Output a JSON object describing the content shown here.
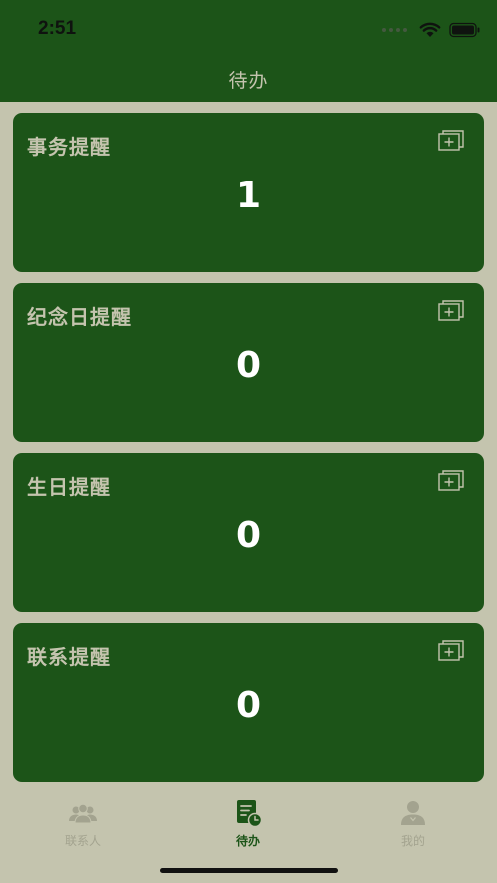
{
  "status": {
    "time": "2:51"
  },
  "nav": {
    "title": "待办"
  },
  "cards": [
    {
      "title": "事务提醒",
      "count": "1"
    },
    {
      "title": "纪念日提醒",
      "count": "0"
    },
    {
      "title": "生日提醒",
      "count": "0"
    },
    {
      "title": "联系提醒",
      "count": "0"
    }
  ],
  "tabs": [
    {
      "label": "联系人",
      "icon": "contacts-icon",
      "active": false
    },
    {
      "label": "待办",
      "icon": "todo-icon",
      "active": true
    },
    {
      "label": "我的",
      "icon": "profile-icon",
      "active": false
    }
  ],
  "colors": {
    "primary": "#1c5418",
    "background": "#c4c4ae",
    "inactive": "#a3a38f"
  }
}
